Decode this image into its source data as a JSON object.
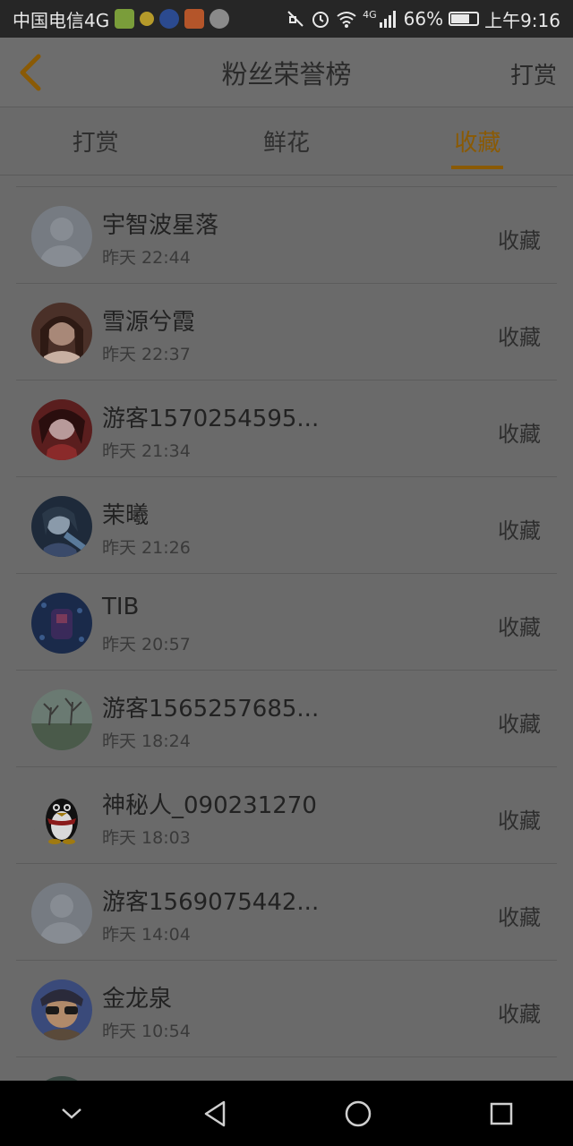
{
  "status_bar": {
    "carrier": "中国电信4G",
    "network": "4G",
    "battery_percent": "66%",
    "time": "上午9:16",
    "app_icon_colors": [
      "#7a9d3a",
      "#b59a2a",
      "#2b4a8f",
      "#b4552a",
      "#6a6a6a"
    ]
  },
  "header": {
    "title": "粉丝荣誉榜",
    "action_label": "打赏",
    "back_icon": "chevron-left-icon",
    "accent_color": "#8a5a05"
  },
  "tabs": [
    {
      "label": "打赏",
      "active": false
    },
    {
      "label": "鲜花",
      "active": false
    },
    {
      "label": "收藏",
      "active": true
    }
  ],
  "list": {
    "items": [
      {
        "name": "宇智波星落",
        "time": "昨天 22:44",
        "action": "收藏",
        "avatar": "default-avatar"
      },
      {
        "name": "雪源兮霞",
        "time": "昨天 22:37",
        "action": "收藏",
        "avatar": "photo-avatar"
      },
      {
        "name": "游客1570254595...",
        "time": "昨天 21:34",
        "action": "收藏",
        "avatar": "photo-avatar"
      },
      {
        "name": "茉曦",
        "time": "昨天 21:26",
        "action": "收藏",
        "avatar": "photo-avatar"
      },
      {
        "name": "TIB",
        "time": "昨天 20:57",
        "action": "收藏",
        "avatar": "photo-avatar"
      },
      {
        "name": "游客1565257685...",
        "time": "昨天 18:24",
        "action": "收藏",
        "avatar": "photo-avatar"
      },
      {
        "name": "神秘人_090231270",
        "time": "昨天 18:03",
        "action": "收藏",
        "avatar": "penguin-avatar"
      },
      {
        "name": "游客1569075442...",
        "time": "昨天 14:04",
        "action": "收藏",
        "avatar": "default-avatar"
      },
      {
        "name": "金龙泉",
        "time": "昨天 10:54",
        "action": "收藏",
        "avatar": "photo-avatar"
      }
    ]
  },
  "nav_bar": {
    "items": [
      "chevron-down-icon",
      "back-triangle-icon",
      "home-circle-icon",
      "recents-square-icon"
    ]
  }
}
